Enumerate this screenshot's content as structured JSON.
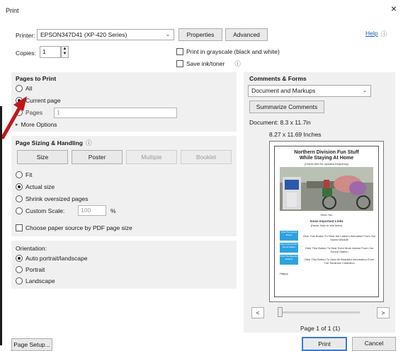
{
  "window": {
    "title": "Print",
    "close_glyph": "×"
  },
  "top": {
    "printer_label": "Printer:",
    "printer_value": "EPSON347D41 (XP-420 Series)",
    "properties_button": "Properties",
    "advanced_button": "Advanced",
    "help_link": "Help",
    "help_icon": "ⓘ",
    "copies_label": "Copies:",
    "copies_value": "1",
    "grayscale_label": "Print in grayscale (black and white)",
    "save_ink_label": "Save ink/toner",
    "save_ink_info": "ⓘ"
  },
  "pages_to_print": {
    "heading": "Pages to Print",
    "options": [
      {
        "label": "All",
        "selected": false
      },
      {
        "label": "Current page",
        "selected": true
      },
      {
        "label": "Pages",
        "selected": false
      }
    ],
    "pages_value": "1",
    "more_options": "More Options"
  },
  "sizing": {
    "heading": "Page Sizing & Handling",
    "info_icon": "ⓘ",
    "tabs": [
      {
        "label": "Size",
        "enabled": true
      },
      {
        "label": "Poster",
        "enabled": true
      },
      {
        "label": "Multiple",
        "enabled": false
      },
      {
        "label": "Booklet",
        "enabled": false
      }
    ],
    "options": [
      {
        "label": "Fit",
        "selected": false
      },
      {
        "label": "Actual size",
        "selected": true
      },
      {
        "label": "Shrink oversized pages",
        "selected": false
      },
      {
        "label": "Custom Scale:",
        "selected": false
      }
    ],
    "custom_scale_value": "100",
    "percent": "%",
    "paper_source_label": "Choose paper source by PDF page size"
  },
  "orientation": {
    "heading": "Orientation:",
    "options": [
      {
        "label": "Auto portrait/landscape",
        "selected": true
      },
      {
        "label": "Portrait",
        "selected": false
      },
      {
        "label": "Landscape",
        "selected": false
      }
    ]
  },
  "comments": {
    "heading": "Comments & Forms",
    "select_value": "Document and Markups",
    "summarize_button": "Summarize Comments",
    "document_size": "Document: 8.3 x 11.7in",
    "page_size": "8.27 x 11.69 Inches"
  },
  "preview_doc": {
    "title_line1": "Northern Division Fun Stuff",
    "title_line2": "While Staying At Home",
    "subtitle": "(Check with for updated frequency)",
    "caption": "Hello You",
    "section_title": "Some Important Links",
    "section_sub": "(Hover links to see them)",
    "links": [
      {
        "box": "Push The Sound Button",
        "text": "Click This Button To Hear the Latest Information From Our Sound Module"
      },
      {
        "box": "Show and Tell Our Sound Station",
        "text": "Click This Button To Hear Even More Advice From Our Sound Station"
      },
      {
        "box": "Push The Beautiful Weather",
        "text": "Click This Button To View All Beautiful Information From The Sunshine Collection"
      }
    ],
    "footer_note": "Happy"
  },
  "nav": {
    "prev": "<",
    "next": ">",
    "page_label": "Page 1 of 1 (1)"
  },
  "footer": {
    "page_setup": "Page Setup...",
    "print": "Print",
    "cancel": "Cancel"
  },
  "colors": {
    "link": "#1a5fb4",
    "arrow": "#c0161b",
    "panel": "#f0f0f0"
  }
}
